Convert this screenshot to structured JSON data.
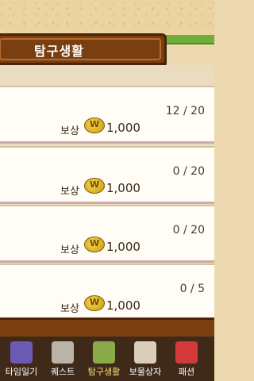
{
  "header": {
    "title": "탐구생활"
  },
  "rewards": [
    {
      "label": "보상",
      "amount": "1,000",
      "progress": "12 / 20"
    },
    {
      "label": "보상",
      "amount": "1,000",
      "progress": "0 / 20"
    },
    {
      "label": "보상",
      "amount": "1,000",
      "progress": "0 / 20"
    },
    {
      "label": "보상",
      "amount": "1,000",
      "progress": "0 / 5"
    }
  ],
  "tabs": [
    {
      "label": "타임일기",
      "icon": "diary-book-icon",
      "color": "#6b5ab3"
    },
    {
      "label": "퀘스트",
      "icon": "scroll-icon",
      "color": "#b9b3a8"
    },
    {
      "label": "탐구생활",
      "icon": "exploration-book-icon",
      "color": "#8aaa4a"
    },
    {
      "label": "보물상자",
      "icon": "treasure-map-icon",
      "color": "#d9cfb8"
    },
    {
      "label": "패션",
      "icon": "shirt-icon",
      "color": "#d23a3a"
    }
  ]
}
